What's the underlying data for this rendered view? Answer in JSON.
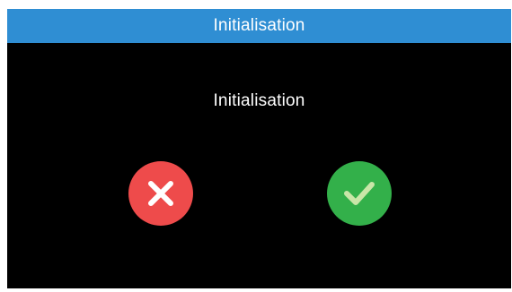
{
  "title_bar": {
    "title": "Initialisation",
    "color": "#2f8ed3"
  },
  "dialog": {
    "message": "Initialisation"
  },
  "buttons": {
    "cancel": {
      "icon": "close-icon",
      "color": "#ee4b4b"
    },
    "confirm": {
      "icon": "check-icon",
      "color": "#33b04a"
    }
  }
}
